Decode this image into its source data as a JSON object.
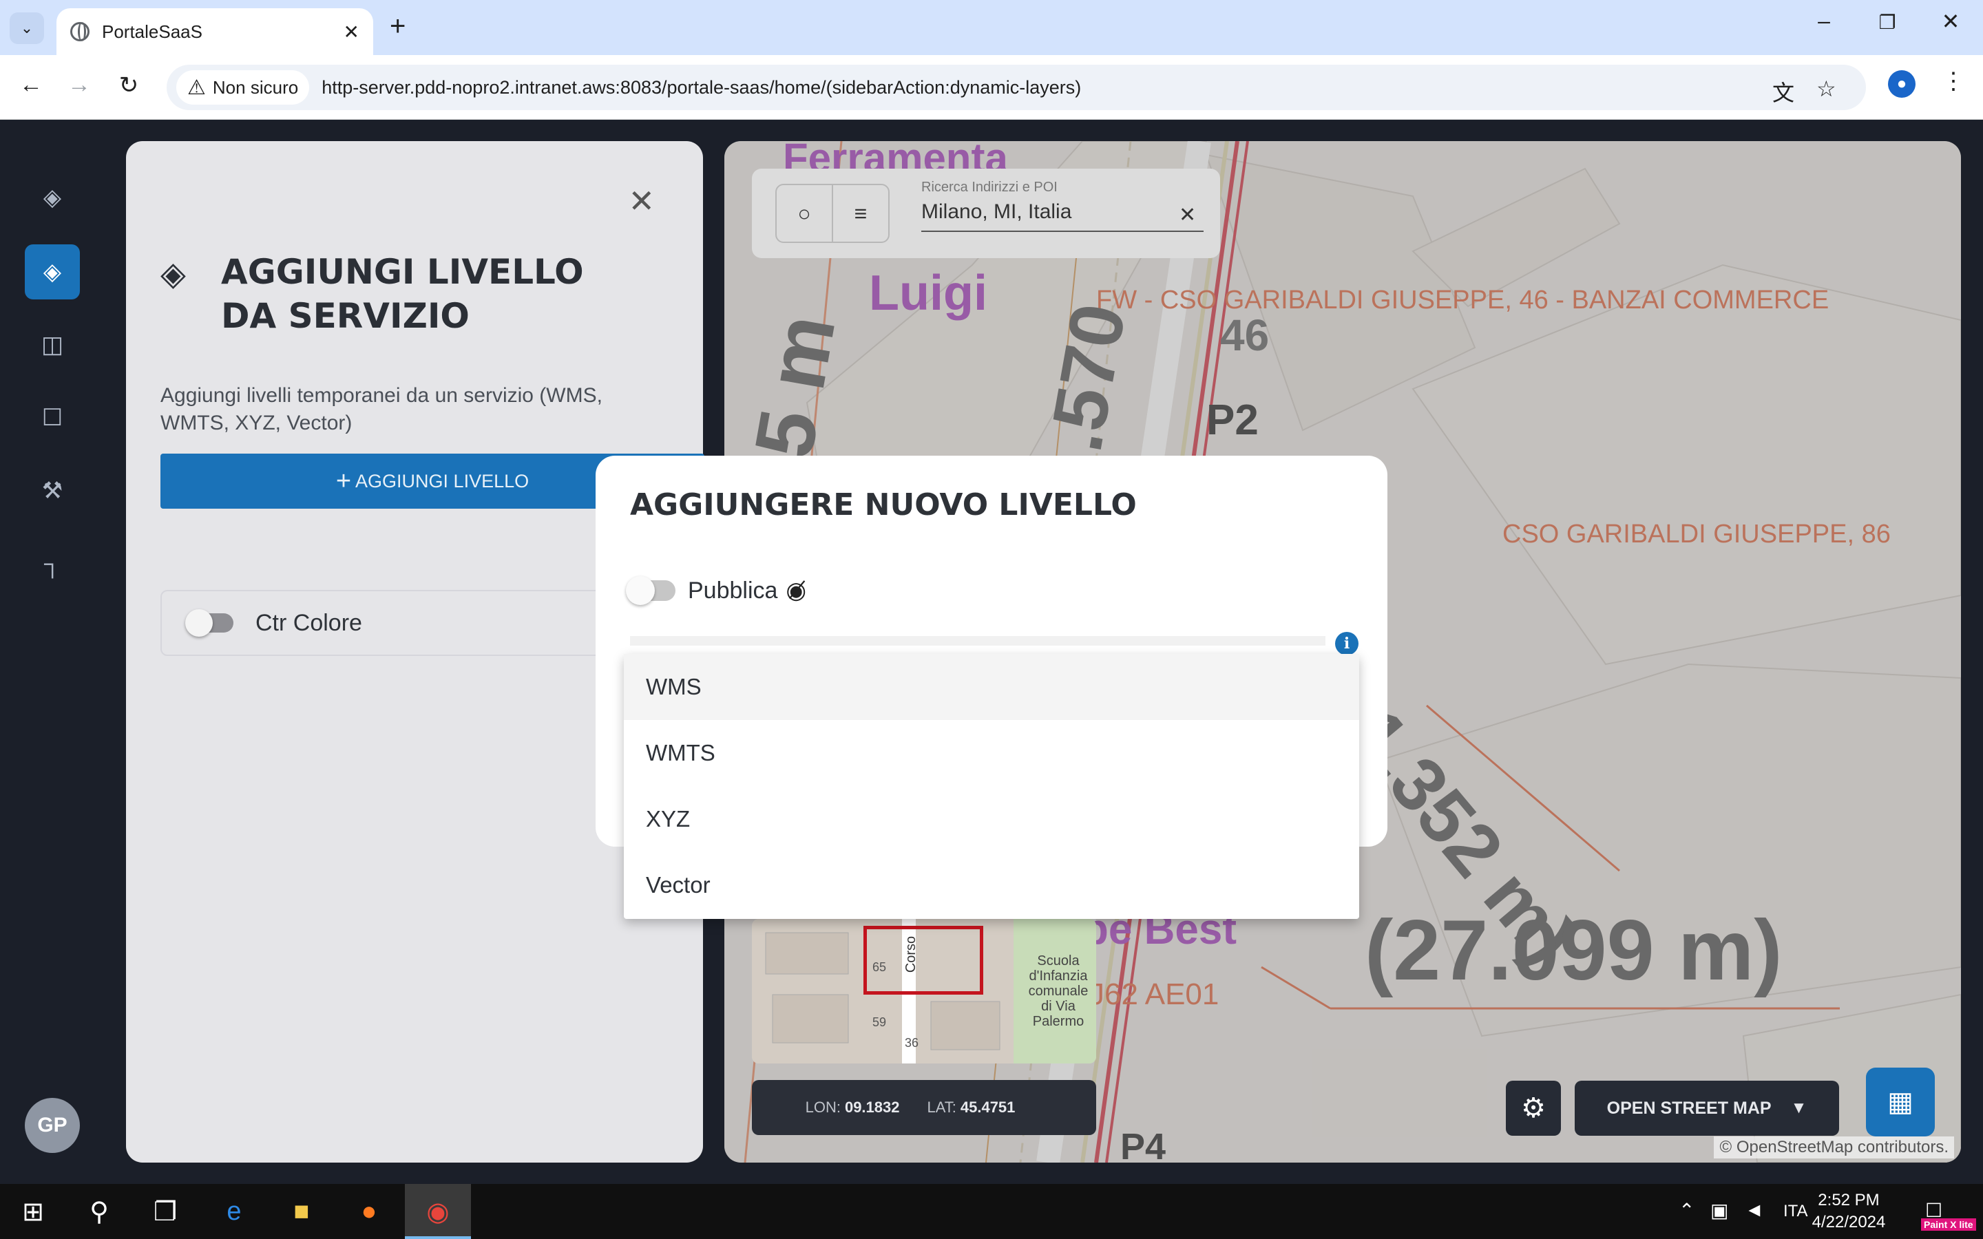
{
  "browser": {
    "tab_title": "PortaleSaaS",
    "security_label": "Non sicuro",
    "url": "http-server.pdd-nopro2.intranet.aws:8083/portale-saas/home/(sidebarAction:dynamic-layers)"
  },
  "sidebar_rail": {
    "items": [
      {
        "icon": "layers-icon"
      },
      {
        "icon": "layers-add-icon",
        "active": true
      },
      {
        "icon": "layout-icon"
      },
      {
        "icon": "bookmarks-icon"
      },
      {
        "icon": "tools-off-icon"
      },
      {
        "icon": "paint-roller-icon"
      }
    ],
    "avatar_initials": "GP"
  },
  "panel": {
    "title": "Aggiungi livello da servizio",
    "description": "Aggiungi livelli temporanei da un servizio (WMS, WMTS, XYZ, Vector)",
    "add_button_label": "AGGIUNGI LIVELLO",
    "ctr_label": "Ctr Colore"
  },
  "map": {
    "search_label": "Ricerca Indirizzi e POI",
    "search_value": "Milano, MI, Italia",
    "labels": {
      "addr1": "FW - CSO GARIBALDI GIUSEPPE, 46 - BANZAI COMMERCE",
      "addr2": "CSO GARIBALDI GIUSEPPE, 86",
      "num46": "46",
      "p2": "P2",
      "p4": "P4",
      "dist1": "(11.352 m)",
      "dist2": "(27.099 m)",
      "code": "J62 AE01",
      "dist3": "55 m",
      "dist4": ".570",
      "ferr": "Ferramenta",
      "luigi": "Luigi",
      "best": "pe Best"
    },
    "minimap_labels": {
      "school": "Scuola d'Infanzia comunale di Via Palermo",
      "corso": "Corso",
      "n65": "65",
      "n59": "59",
      "n36": "36"
    },
    "coords": {
      "lon_label": "LON:",
      "lon": "09.1832",
      "lat_label": "LAT:",
      "lat": "45.4751"
    },
    "basemap_label": "OPEN STREET MAP",
    "attribution": "© OpenStreetMap contributors."
  },
  "modal": {
    "title": "AGGIUNGERE NUOVO LIVELLO",
    "public_label": "Pubblica",
    "options": [
      "WMS",
      "WMTS",
      "XYZ",
      "Vector"
    ]
  },
  "taskbar": {
    "lang": "ITA",
    "time": "2:52 PM",
    "date": "4/22/2024",
    "paintx": "Paint X lite"
  },
  "colors": {
    "accent": "#1a72b8",
    "map_red": "#c4141e",
    "label_orange": "#d9552a"
  }
}
